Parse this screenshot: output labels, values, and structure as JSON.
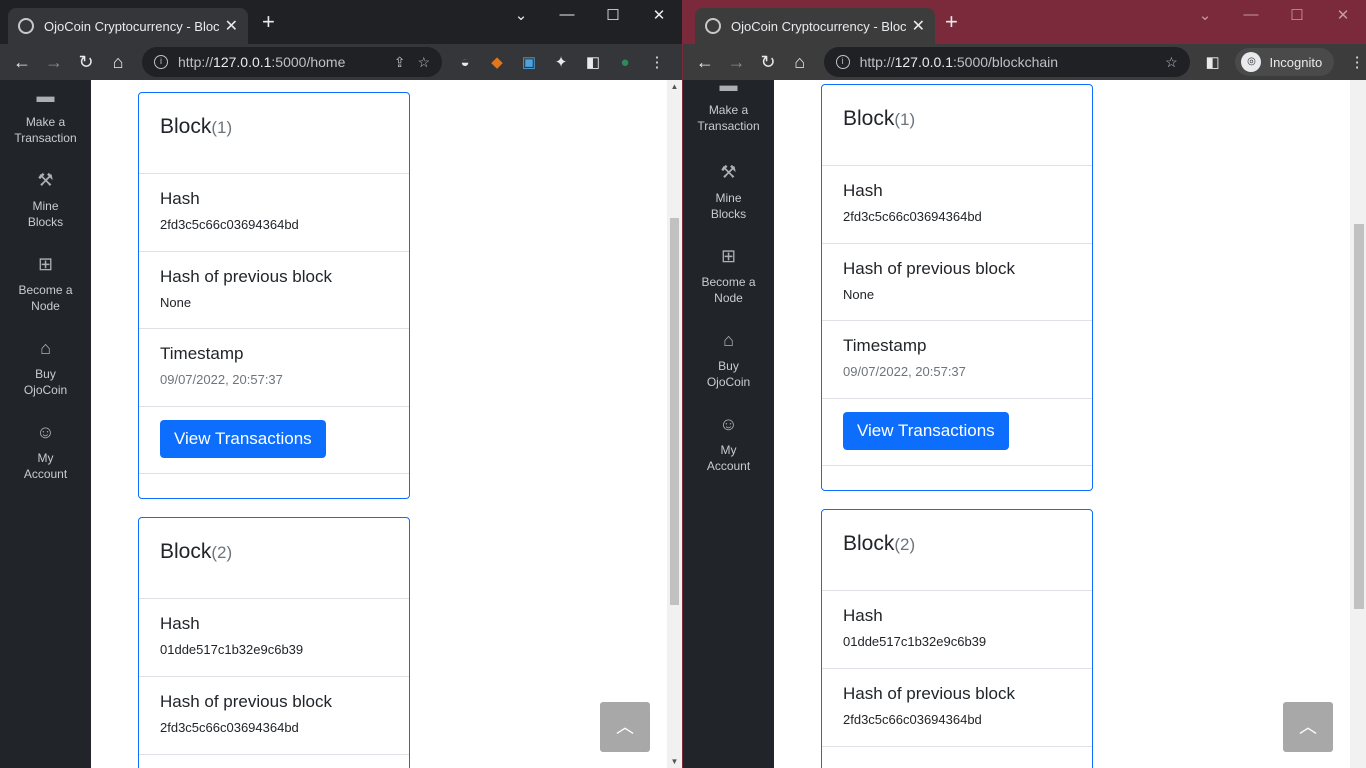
{
  "left": {
    "tab_title": "OjoCoin Cryptocurrency - Blockch",
    "url_scheme": "http://",
    "url_host": "127.0.0.1",
    "url_rest": ":5000/home"
  },
  "right": {
    "tab_title": "OjoCoin Cryptocurrency - Blockch",
    "url_scheme": "http://",
    "url_host": "127.0.0.1",
    "url_rest": ":5000/blockchain",
    "incognito": "Incognito"
  },
  "sidebar": {
    "items": [
      {
        "label1": "Make a",
        "label2": "Transaction",
        "icon": "credit-card-icon"
      },
      {
        "label1": "Mine",
        "label2": "Blocks",
        "icon": "hammer-icon"
      },
      {
        "label1": "Become a",
        "label2": "Node",
        "icon": "network-icon"
      },
      {
        "label1": "Buy",
        "label2": "OjoCoin",
        "icon": "store-icon"
      },
      {
        "label1": "My",
        "label2": "Account",
        "icon": "user-icon"
      }
    ]
  },
  "blocks": [
    {
      "title": "Block",
      "num": "(1)",
      "hash_label": "Hash",
      "hash": "2fd3c5c66c03694364bd",
      "prev_label": "Hash of previous block",
      "prev": "None",
      "ts_label": "Timestamp",
      "ts": "09/07/2022, 20:57:37",
      "button": "View Transactions"
    },
    {
      "title": "Block",
      "num": "(2)",
      "hash_label": "Hash",
      "hash": "01dde517c1b32e9c6b39",
      "prev_label": "Hash of previous block",
      "prev": "2fd3c5c66c03694364bd"
    }
  ]
}
